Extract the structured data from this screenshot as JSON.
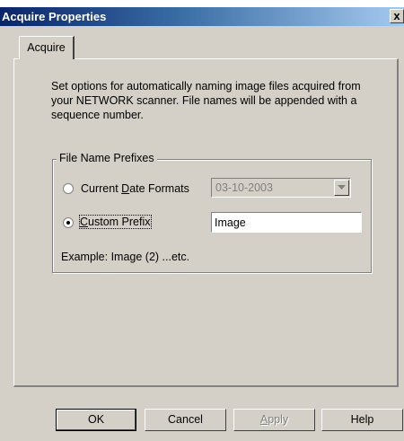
{
  "window": {
    "title": "Acquire Properties",
    "close_glyph": "x"
  },
  "tabs": [
    {
      "label": "Acquire",
      "selected": true
    }
  ],
  "description": "Set options for automatically naming image files acquired from your NETWORK scanner. File names will be appended with a sequence number.",
  "group": {
    "legend": "File Name Prefixes",
    "options": [
      {
        "label_pre": "Current ",
        "label_accel": "D",
        "label_post": "ate Formats",
        "checked": false
      },
      {
        "label_pre": "",
        "label_accel": "C",
        "label_post": "ustom Prefix",
        "checked": true
      }
    ],
    "date_format_value": "03-10-2003",
    "custom_prefix_value": "Image",
    "example": "Example: Image (2) ...etc."
  },
  "buttons": {
    "ok": "OK",
    "cancel": "Cancel",
    "apply_accel": "A",
    "apply_rest": "pply",
    "help": "Help"
  }
}
